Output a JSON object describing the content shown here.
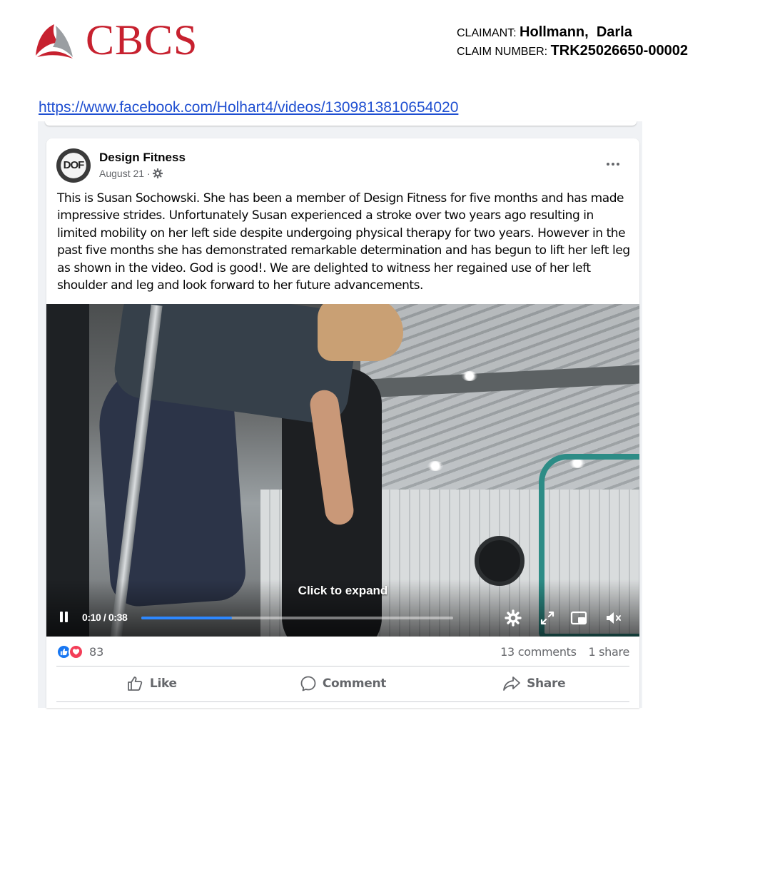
{
  "letterhead": {
    "logo_text": "CBCS",
    "claimant_label": "CLAIMANT:",
    "claimant_value": "Hollmann,  Darla",
    "claim_number_label": "CLAIM NUMBER:",
    "claim_number_value": "TRK25026650-00002",
    "brand_color": "#c7212f"
  },
  "source_url": "https://www.facebook.com/Holhart4/videos/1309813810654020",
  "post": {
    "avatar_text": "DOF",
    "page_name": "Design Fitness",
    "date": "August 21 ·",
    "audience_icon": "gear-icon",
    "more_icon": "more-dots-icon",
    "text": "This is Susan Sochowski. She has been a member of Design Fitness for five months and has made impressive strides. Unfortunately Susan experienced a stroke over two years ago resulting in limited mobility on her left side despite undergoing physical therapy for two years. However in the past five months she has demonstrated remarkable determination and has begun to lift her left leg as shown in the video. God is good!. We are delighted to witness her regained use of her left shoulder and leg and look forward to her future advancements."
  },
  "video": {
    "expand_hint": "Click to expand",
    "current_time": "0:10",
    "duration": "0:38",
    "time_separator": "/",
    "progress_fraction": 0.29,
    "icons": [
      "pause-icon",
      "settings-icon",
      "fullscreen-icon",
      "picture-in-picture-icon",
      "mute-icon"
    ]
  },
  "footer": {
    "reaction_count": "83",
    "comments": "13 comments",
    "shares": "1 share",
    "like_label": "Like",
    "comment_label": "Comment",
    "share_label": "Share",
    "accent_color": "#1877f2",
    "love_color": "#f33e58"
  }
}
